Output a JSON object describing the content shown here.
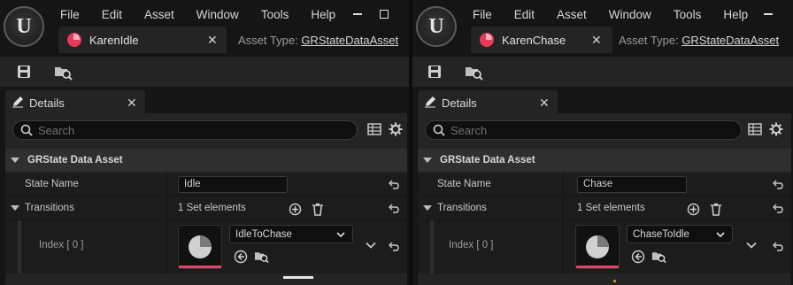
{
  "left": {
    "menu": [
      "File",
      "Edit",
      "Asset",
      "Window",
      "Tools",
      "Help"
    ],
    "tab_label": "KarenIdle",
    "asset_type_label": "Asset Type:",
    "asset_type_value": "GRStateDataAsset",
    "details_tab": "Details",
    "search_placeholder": "Search",
    "category": "GRState Data Asset",
    "state_name_label": "State Name",
    "state_name_value": "Idle",
    "transitions_label": "Transitions",
    "transitions_count": "1 Set elements",
    "index_label": "Index [ 0 ]",
    "transition_value": "IdleToChase"
  },
  "right": {
    "menu": [
      "File",
      "Edit",
      "Asset",
      "Window",
      "Tools",
      "Help"
    ],
    "tab_label": "KarenChase",
    "asset_type_label": "Asset Type:",
    "asset_type_value": "GRStateDataAsset",
    "details_tab": "Details",
    "search_placeholder": "Search",
    "category": "GRState Data Asset",
    "state_name_label": "State Name",
    "state_name_value": "Chase",
    "transitions_label": "Transitions",
    "transitions_count": "1 Set elements",
    "index_label": "Index [ 0 ]",
    "transition_value": "ChaseToIdle"
  },
  "colors": {
    "accent": "#e83a5a",
    "panel": "#242424",
    "row": "#1c1c1c"
  },
  "icons": [
    "unreal-logo-icon",
    "asset-icon",
    "save-icon",
    "browse-icon",
    "pencil-icon",
    "grid-icon",
    "gear-icon",
    "reset-icon",
    "add-icon",
    "delete-icon",
    "chevron-down-icon",
    "use-selected-icon"
  ]
}
